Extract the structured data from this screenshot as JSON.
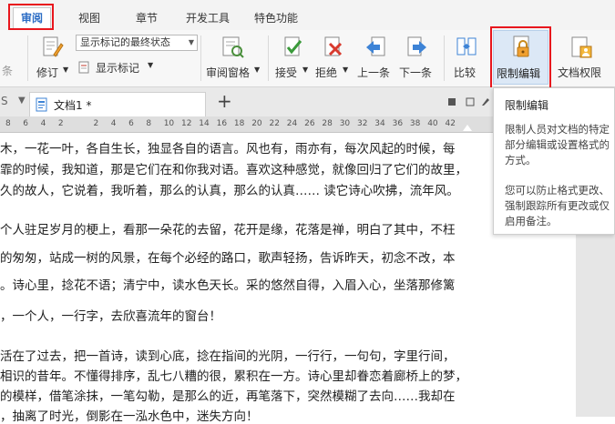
{
  "menu": {
    "tabs": [
      {
        "label": "审阅",
        "active": true
      },
      {
        "label": "视图"
      },
      {
        "label": "章节"
      },
      {
        "label": "开发工具"
      },
      {
        "label": "特色功能"
      }
    ]
  },
  "ribbon": {
    "prev_cut_label": "条",
    "revise_label": "修订",
    "markup_select_value": "显示标记的最终状态",
    "show_markup_label": "显示标记",
    "review_pane_label": "审阅窗格",
    "accept_label": "接受",
    "reject_label": "拒绝",
    "prev_label": "上一条",
    "next_label": "下一条",
    "compare_label": "比较",
    "restrict_edit_label": "限制编辑",
    "doc_rights_label": "文档权限"
  },
  "tabbar": {
    "left_cut": "S",
    "doc_tab_label": "文档1 *",
    "add_tab": "+"
  },
  "ruler": {
    "numbers": [
      "8",
      "6",
      "4",
      "2",
      "",
      "2",
      "4",
      "6",
      "8",
      "10",
      "12",
      "14",
      "16",
      "18",
      "20",
      "22",
      "24",
      "26",
      "28",
      "30",
      "32",
      "34",
      "36",
      "38",
      "40",
      "42"
    ]
  },
  "document": {
    "lines": [
      "木，一花一叶，各自生长，独显各自的语言。风也有，雨亦有，每次风起的时候，每",
      "霏的时候，我知道，那是它们在和你我对语。喜欢这种感觉，就像回归了它们的故里，",
      "久的故人，它说着，我听着，那么的认真，那么的认真…… 读它诗心吹拂，流年风。",
      "个人驻足岁月的梗上，看那一朵花的去留，花开是缘，花落是禅，明白了其中，不枉",
      "的匆匆，站成一树的风景，在每个必经的路口，歌声轻扬，告诉昨天，初念不改，本",
      "。诗心里，捻花不语；清宁中，读水色天长。采的悠然自得，入眉入心，坐落那修篱",
      "，一个人，一行字，去欣喜流年的窗台！",
      "活在了过去，把一首诗，读到心底，捻在指间的光阴，一行行，一句句，字里行间，",
      "相识的昔年。不懂得排序，乱七八糟的很，累积在一方。诗心里却眷恋着廊桥上的梦，",
      "的模样，借笔涂抹，一笔勾勒，是那么的近，再笔落下，突然模糊了去向……我却在",
      "，抽离了时光，倒影在一泓水色中，迷失方向！"
    ]
  },
  "tooltip": {
    "title": "限制编辑",
    "lines": [
      "限制人员对文档的特定",
      "部分编辑或设置格式的",
      "方式。",
      "",
      "您可以防止格式更改、",
      "强制跟踪所有更改或仅",
      "启用备注。"
    ]
  },
  "colors": {
    "accent": "#2b6cc4",
    "highlight_box": "#e8161d",
    "active_button_bg": "#dce8f6"
  }
}
